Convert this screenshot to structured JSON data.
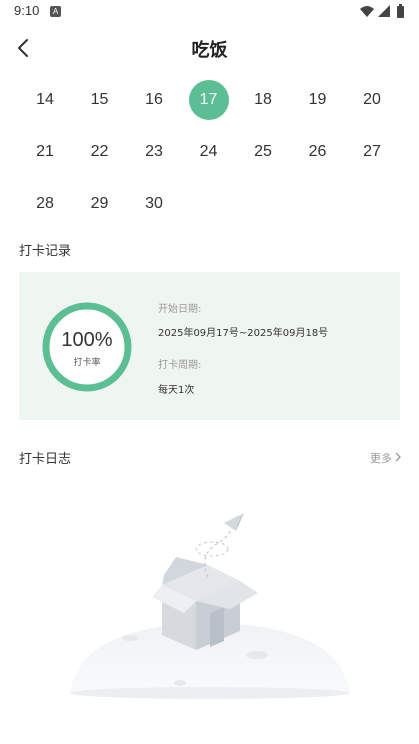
{
  "status_bar": {
    "time": "9:10",
    "notification_icon": "A"
  },
  "header": {
    "title": "吃饭"
  },
  "calendar": {
    "days": [
      "14",
      "15",
      "16",
      "17",
      "18",
      "19",
      "20",
      "21",
      "22",
      "23",
      "24",
      "25",
      "26",
      "27",
      "28",
      "29",
      "30"
    ],
    "selected": "17",
    "accent_color": "#5bbf93"
  },
  "checkin_record": {
    "section_title": "打卡记录",
    "percent": "100%",
    "percent_label": "打卡率",
    "progress_value": 1.0,
    "start_date_label": "开始日期:",
    "start_date_value": "2025年09月17号~2025年09月18号",
    "cycle_label": "打卡周期:",
    "cycle_value": "每天1次"
  },
  "checkin_log": {
    "section_title": "打卡日志",
    "more_label": "更多"
  },
  "colors": {
    "accent": "#5bbf93",
    "card_bg": "#eff6f2"
  }
}
